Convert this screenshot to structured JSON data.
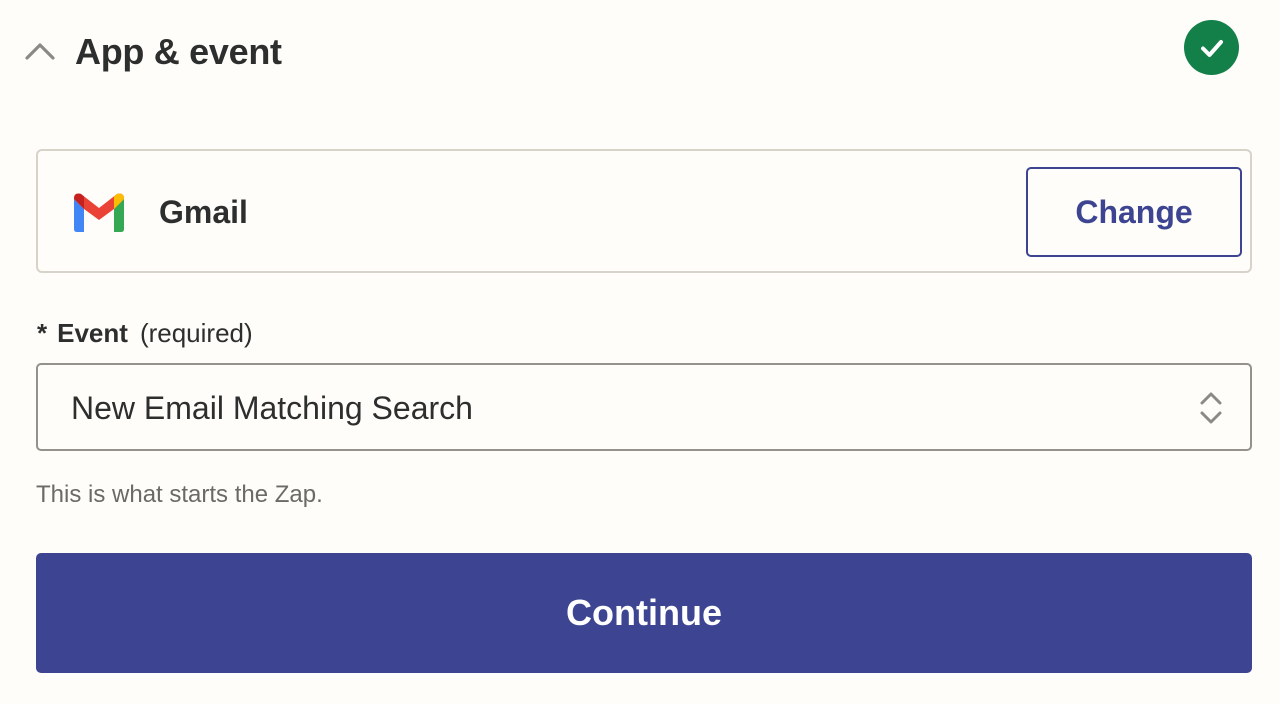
{
  "section": {
    "title": "App & event",
    "status": "complete",
    "status_color": "#13804a",
    "collapse_icon": "chevron-up-icon"
  },
  "app": {
    "name": "Gmail",
    "logo_icon": "gmail-logo-icon",
    "change_label": "Change"
  },
  "event": {
    "required_marker": "*",
    "label": "Event",
    "required_text": "(required)",
    "selected_value": "New Email Matching Search",
    "select_icon": "chevron-up-down-icon",
    "helper_text": "This is what starts the Zap."
  },
  "actions": {
    "continue_label": "Continue",
    "accent_color": "#3d4592"
  }
}
